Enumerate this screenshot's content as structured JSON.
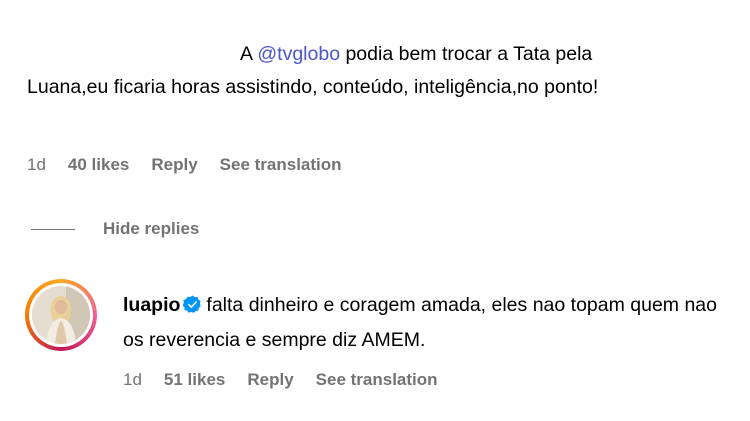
{
  "comment": {
    "text_prefix": "A ",
    "mention": "@tvglobo",
    "text_line1_rest": " podia bem trocar a Tata pela",
    "text_rest": "Luana,eu ficaria horas assistindo, conteúdo, inteligência,no ponto!",
    "time": "1d",
    "likes": "40 likes",
    "reply_label": "Reply",
    "translate_label": "See translation"
  },
  "hide_replies_label": "Hide replies",
  "reply": {
    "username": "luapio",
    "text": "falta dinheiro e coragem amada, eles nao topam quem nao os reverencia e sempre diz AMEM.",
    "time": "1d",
    "likes": "51 likes",
    "reply_label": "Reply",
    "translate_label": "See translation"
  },
  "colors": {
    "mention": "#4a57c9",
    "meta": "#737373",
    "verified": "#0095f6"
  },
  "icons": {
    "verified": "verified-badge-icon"
  }
}
